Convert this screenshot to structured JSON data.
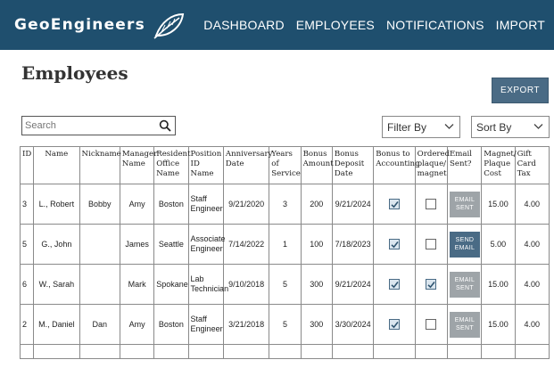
{
  "header": {
    "logo_text": "GeoEngineers",
    "nav": [
      "DASHBOARD",
      "EMPLOYEES",
      "NOTIFICATIONS",
      "IMPORT"
    ]
  },
  "page": {
    "title": "Employees",
    "export_label": "EXPORT"
  },
  "search": {
    "placeholder": "Search",
    "icon": "search-icon"
  },
  "filter": {
    "label": "Filter By"
  },
  "sort": {
    "label": "Sort By"
  },
  "table": {
    "columns": [
      "ID",
      "Name",
      "Nickname",
      "Manager Name",
      "Resident Office Name",
      "Position ID Name",
      "Anniversary Date",
      "Years of Service",
      "Bonus Amount",
      "Bonus Deposit Date",
      "Bonus to Accounting",
      "Ordered plaque/ magnet",
      "Email Sent?",
      "Magnet/ Plaque Cost",
      "Gift Card Tax"
    ],
    "rows": [
      {
        "id": "3",
        "name": "L., Robert",
        "nickname": "Bobby",
        "manager": "Amy",
        "office": "Boston",
        "position": "Staff Engineer",
        "anniversary": "9/21/2020",
        "years": "3",
        "bonus": "200",
        "deposit": "9/21/2024",
        "bonus_to_accounting": true,
        "ordered_plaque": false,
        "email": "EMAIL SENT",
        "email_state": "sent",
        "cost": "15.00",
        "tax": "4.00"
      },
      {
        "id": "5",
        "name": "G., John",
        "nickname": "",
        "manager": "James",
        "office": "Seattle",
        "position": "Associate Engineer",
        "anniversary": "7/14/2022",
        "years": "1",
        "bonus": "100",
        "deposit": "7/18/2023",
        "bonus_to_accounting": true,
        "ordered_plaque": false,
        "email": "SEND EMAIL",
        "email_state": "send",
        "cost": "5.00",
        "tax": "4.00"
      },
      {
        "id": "6",
        "name": "W., Sarah",
        "nickname": "",
        "manager": "Mark",
        "office": "Spokane",
        "position": "Lab Technician",
        "anniversary": "9/10/2018",
        "years": "5",
        "bonus": "300",
        "deposit": "9/21/2024",
        "bonus_to_accounting": true,
        "ordered_plaque": true,
        "email": "EMAIL SENT",
        "email_state": "sent",
        "cost": "15.00",
        "tax": "4.00"
      },
      {
        "id": "2",
        "name": "M., Daniel",
        "nickname": "Dan",
        "manager": "Amy",
        "office": "Boston",
        "position": "Staff Engineer",
        "anniversary": "3/21/2018",
        "years": "5",
        "bonus": "300",
        "deposit": "3/30/2024",
        "bonus_to_accounting": true,
        "ordered_plaque": false,
        "email": "EMAIL SENT",
        "email_state": "sent",
        "cost": "15.00",
        "tax": "4.00"
      }
    ]
  },
  "colors": {
    "header_bg": "#1f4f6e",
    "button_bg": "#4a6b85",
    "sent_bg": "#9ea4a8"
  }
}
